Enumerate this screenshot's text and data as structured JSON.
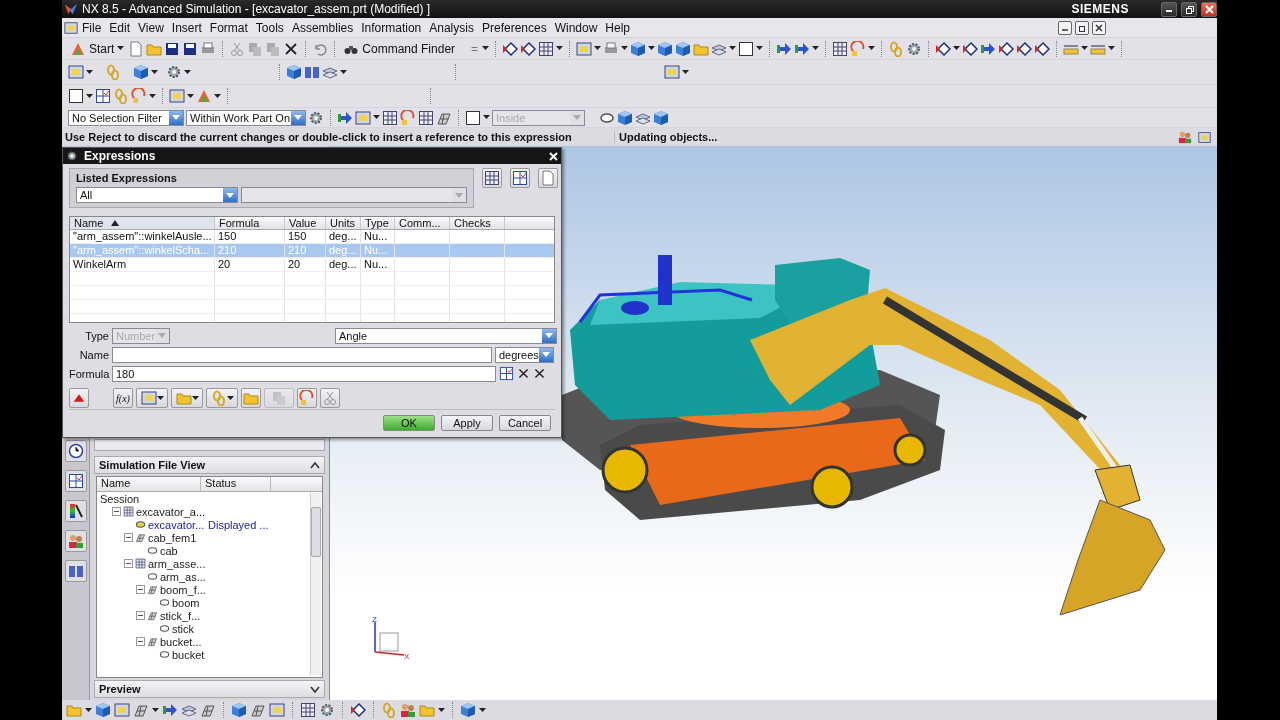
{
  "window": {
    "title": "NX 8.5 - Advanced Simulation - [excavator_assem.prt (Modified) ]",
    "brand": "SIEMENS"
  },
  "menu": [
    "File",
    "Edit",
    "View",
    "Insert",
    "Format",
    "Tools",
    "Assemblies",
    "Information",
    "Analysis",
    "Preferences",
    "Window",
    "Help"
  ],
  "toolbar": {
    "start_label": "Start",
    "command_finder": "Command Finder",
    "finder_symbol": "="
  },
  "selection_bar": {
    "filter": "No Selection Filter",
    "scope": "Within Work Part On",
    "mode": {
      "value": "Inside",
      "disabled": true
    }
  },
  "status": {
    "prompt": "Use Reject to discard the current changes or double-click to insert a reference to this expression",
    "message": "Updating objects..."
  },
  "expressions_dialog": {
    "title": "Expressions",
    "listed": {
      "heading": "Listed Expressions",
      "filter": "All"
    },
    "columns": [
      {
        "label": "Name",
        "sorted": true
      },
      {
        "label": "Formula",
        "sorted": false
      },
      {
        "label": "Value",
        "sorted": false
      },
      {
        "label": "Units",
        "sorted": false
      },
      {
        "label": "Type",
        "sorted": false
      },
      {
        "label": "Comm...",
        "sorted": false
      },
      {
        "label": "Checks",
        "sorted": false
      }
    ],
    "rows": [
      {
        "name": "\"arm_assem\"::winkelAusle...",
        "formula": "150",
        "value": "150",
        "units": "deg...",
        "type": "Nu...",
        "selected": false
      },
      {
        "name": "\"arm_assem\"::winkelScha...",
        "formula": "210",
        "value": "210",
        "units": "deg...",
        "type": "Nu...",
        "selected": true
      },
      {
        "name": "WinkelArm",
        "formula": "20",
        "value": "20",
        "units": "deg...",
        "type": "Nu...",
        "selected": false
      }
    ],
    "type_field": {
      "label": "Type",
      "value": "Number",
      "disabled": true
    },
    "dimension": "Angle",
    "name_field": {
      "label": "Name",
      "units": "degrees"
    },
    "formula_field": {
      "label": "Formula",
      "value": "180"
    },
    "function_button": "f(x)",
    "buttons": [
      {
        "label": "OK",
        "default": true
      },
      {
        "label": "Apply",
        "default": false
      },
      {
        "label": "Cancel",
        "default": false
      }
    ]
  },
  "navigator": {
    "section": "Simulation File View",
    "expanded": true,
    "columns": [
      "Name",
      "Status"
    ],
    "tree": [
      {
        "name": "Session",
        "children": [
          {
            "name": "excavator_a...",
            "kind": "assembly",
            "expanded": true,
            "children": [
              {
                "name": "excavator...",
                "kind": "part",
                "status": "Displayed ..."
              },
              {
                "name": "cab_fem1",
                "kind": "fem",
                "expanded": true,
                "children": [
                  {
                    "name": "cab",
                    "kind": "part"
                  }
                ]
              },
              {
                "name": "arm_asse...",
                "kind": "assembly",
                "expanded": true,
                "children": [
                  {
                    "name": "arm_as...",
                    "kind": "part"
                  },
                  {
                    "name": "boom_f...",
                    "kind": "fem",
                    "expanded": true,
                    "children": [
                      {
                        "name": "boom",
                        "kind": "part"
                      }
                    ]
                  },
                  {
                    "name": "stick_f...",
                    "kind": "fem",
                    "expanded": true,
                    "children": [
                      {
                        "name": "stick",
                        "kind": "part"
                      }
                    ]
                  },
                  {
                    "name": "bucket...",
                    "kind": "fem",
                    "expanded": true,
                    "children": [
                      {
                        "name": "bucket",
                        "kind": "part"
                      }
                    ]
                  }
                ]
              }
            ]
          }
        ]
      }
    ],
    "preview": {
      "label": "Preview",
      "expanded": false
    }
  },
  "viewport": {
    "triad_labels": [
      "Z",
      "X"
    ]
  }
}
